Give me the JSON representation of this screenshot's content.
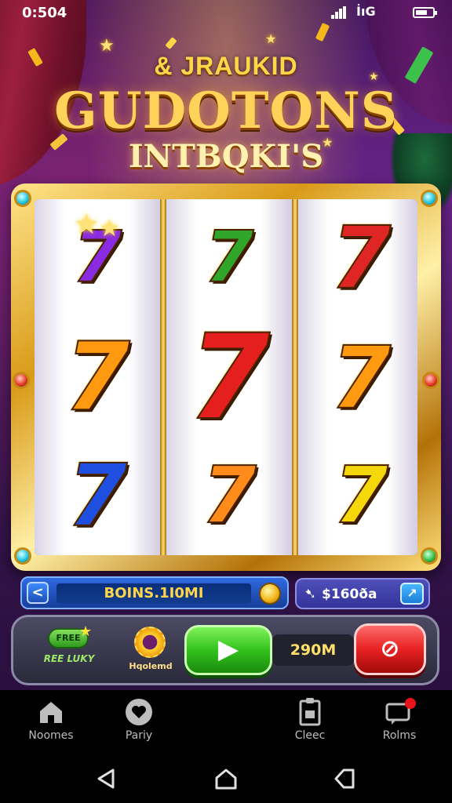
{
  "status_bar": {
    "time": "0:504",
    "network": "İıG"
  },
  "title": {
    "top": "& JRAUKID",
    "main": "GUDOTONS",
    "sub": "INTBQKI'S"
  },
  "reels": [
    {
      "symbols": [
        {
          "text": "7",
          "color": "#8a2be2",
          "size": 90
        },
        {
          "text": "7",
          "color": "#ff9a10",
          "size": 120
        },
        {
          "text": "7",
          "color": "#1f4fe0",
          "size": 110
        }
      ]
    },
    {
      "symbols": [
        {
          "text": "7",
          "color": "#2fa52a",
          "size": 90
        },
        {
          "text": "7",
          "color": "#e51e1e",
          "size": 150
        },
        {
          "text": "7",
          "color": "#ff8c1a",
          "size": 100
        }
      ]
    },
    {
      "symbols": [
        {
          "text": "7",
          "color": "#e02525",
          "size": 110
        },
        {
          "text": "7",
          "color": "#ff9a10",
          "size": 110
        },
        {
          "text": "7",
          "color": "#f5d80a",
          "size": 100
        }
      ]
    }
  ],
  "bonus_bar": {
    "text": "BOINS.1I0MI",
    "arrow": "<"
  },
  "win_box": {
    "text": "$160ða"
  },
  "controls": {
    "free_spin_pill": "FREE",
    "free_spin_label": "REE LUKY",
    "reload_label": "Hqolemd",
    "bet_amount": "290M"
  },
  "bottom_nav": {
    "items": [
      {
        "label": "Noomes",
        "icon": "home-icon"
      },
      {
        "label": "Pariy",
        "icon": "heart-icon"
      },
      {
        "label": "Cleec",
        "icon": "clipboard-icon"
      },
      {
        "label": "Rolms",
        "icon": "chat-icon"
      }
    ]
  },
  "colors": {
    "gold": "#ffd35a",
    "spin_green": "#32c21d",
    "max_red": "#e82222",
    "bonus_blue": "#2e6ae0",
    "notification_red": "#e8141a"
  }
}
